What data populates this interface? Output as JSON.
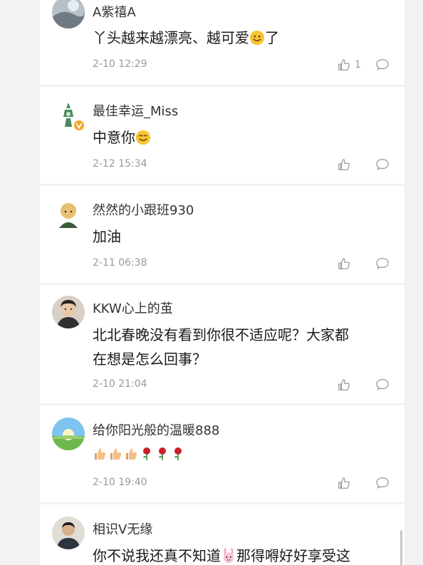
{
  "comments": [
    {
      "user": "A紫禧A",
      "text_before": "丫头越来越漂亮、越可爱",
      "emoji_mid": "smile-emoji",
      "text_after": "了",
      "time": "2-10 12:29",
      "like_count": "1"
    },
    {
      "user": "最佳幸运_Miss",
      "text_before": "中意你",
      "emoji_mid": "smile-emoji",
      "text_after": "",
      "time": "2-12 15:34",
      "like_count": "",
      "verified": true
    },
    {
      "user": "然然的小跟班930",
      "text_before": "加油",
      "time": "2-11 06:38",
      "like_count": ""
    },
    {
      "user": "KKW心上的茧",
      "text_line1": "北北春晚没有看到你很不适应呢？大家都",
      "text_line2": "在想是怎么回事？",
      "time": "2-10 21:04",
      "like_count": ""
    },
    {
      "user": "给你阳光般的温暖888",
      "emojis": [
        "thumbs-up-emoji",
        "thumbs-up-emoji",
        "thumbs-up-emoji",
        "rose-emoji",
        "rose-emoji",
        "rose-emoji"
      ],
      "time": "2-10 19:40",
      "like_count": ""
    },
    {
      "user": "相识V无缘",
      "text_before": "你不说我还真不知道",
      "emoji_mid": "bunny-emoji",
      "text_after": "那得嘚好好享受这",
      "time": "",
      "like_count": ""
    }
  ],
  "colors": {
    "background": "#f2f2f2",
    "card": "#ffffff",
    "name": "#333333",
    "meta": "#999999",
    "verified_badge": "#f5a623"
  }
}
